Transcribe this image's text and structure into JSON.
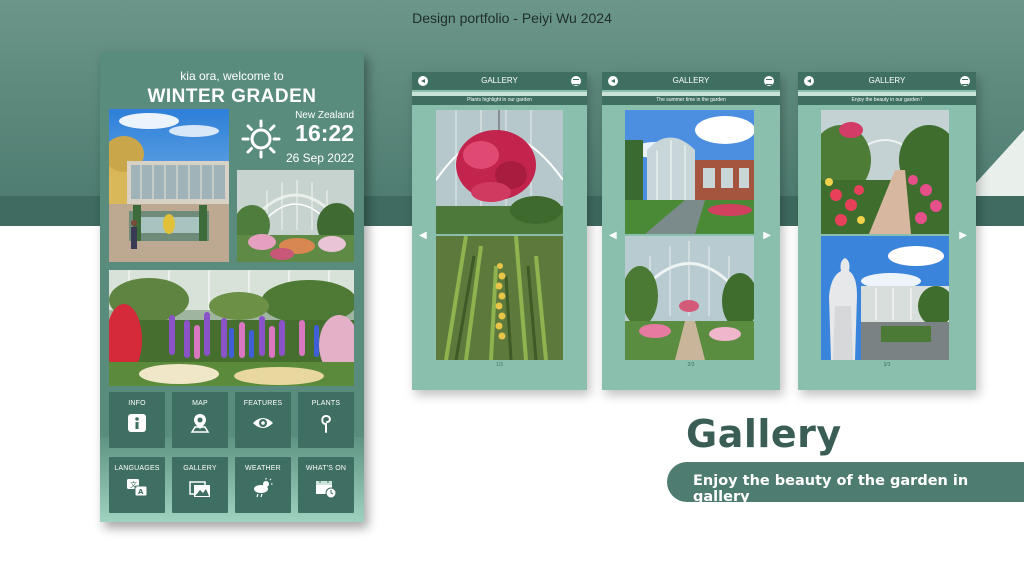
{
  "header": {
    "portfolio_title": "Design portfolio - Peiyi Wu 2024"
  },
  "kiosk": {
    "welcome": "kia ora, welcome to",
    "garden_name": "WINTER GRADEN",
    "weather": {
      "icon": "sun-icon",
      "country": "New Zealand",
      "time": "16:22",
      "date": "26 Sep 2022"
    },
    "menu": [
      {
        "label": "INFO",
        "icon": "info-icon"
      },
      {
        "label": "MAP",
        "icon": "map-pin-icon"
      },
      {
        "label": "FEATURES",
        "icon": "eye-icon"
      },
      {
        "label": "PLANTS",
        "icon": "plant-icon"
      },
      {
        "label": "LANGUAGES",
        "icon": "translate-icon"
      },
      {
        "label": "GALLERY",
        "icon": "gallery-icon"
      },
      {
        "label": "WEATHER",
        "icon": "weather-icon"
      },
      {
        "label": "WHAT'S ON",
        "icon": "calendar-icon"
      }
    ]
  },
  "gallery_screens": [
    {
      "title": "GALLERY",
      "subtitle": "Plants highlight in our garden",
      "page": "1/3"
    },
    {
      "title": "GALLERY",
      "subtitle": "The summer time in the garden",
      "page": "2/3"
    },
    {
      "title": "GALLERY",
      "subtitle": "Enjoy the beauty in our garden !",
      "page": "3/3"
    }
  ],
  "feature": {
    "heading": "Gallery",
    "tagline": "Enjoy the beauty of the garden in gallery"
  },
  "colors": {
    "primary": "#5a8c7e",
    "dark": "#3e6f61",
    "light": "#8bbfad",
    "heading": "#3a5e56"
  }
}
